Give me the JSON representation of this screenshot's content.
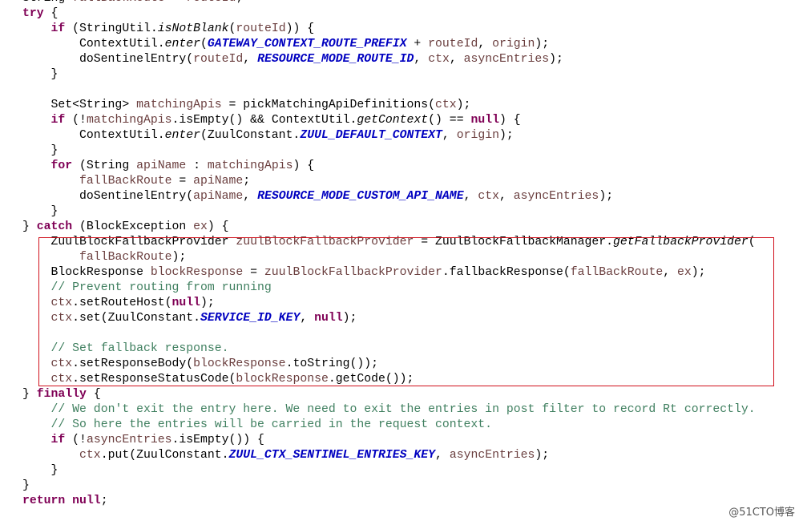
{
  "highlight_color": "#d0101c",
  "watermark": "@51CTO博客",
  "lines": [
    [
      [
        "p",
        "String "
      ],
      [
        "v",
        "fallBackRoute"
      ],
      [
        "p",
        " = "
      ],
      [
        "v",
        "routeId"
      ],
      [
        "p",
        ";"
      ]
    ],
    [
      [
        "k",
        "try"
      ],
      [
        "p",
        " {"
      ]
    ],
    [
      [
        "p",
        "    "
      ],
      [
        "k",
        "if"
      ],
      [
        "p",
        " (StringUtil."
      ],
      [
        "s",
        "isNotBlank"
      ],
      [
        "p",
        "("
      ],
      [
        "v",
        "routeId"
      ],
      [
        "p",
        ")) {"
      ]
    ],
    [
      [
        "p",
        "        ContextUtil."
      ],
      [
        "s",
        "enter"
      ],
      [
        "p",
        "("
      ],
      [
        "f",
        "GATEWAY_CONTEXT_ROUTE_PREFIX"
      ],
      [
        "p",
        " + "
      ],
      [
        "v",
        "routeId"
      ],
      [
        "p",
        ", "
      ],
      [
        "v",
        "origin"
      ],
      [
        "p",
        ");"
      ]
    ],
    [
      [
        "p",
        "        doSentinelEntry("
      ],
      [
        "v",
        "routeId"
      ],
      [
        "p",
        ", "
      ],
      [
        "f",
        "RESOURCE_MODE_ROUTE_ID"
      ],
      [
        "p",
        ", "
      ],
      [
        "v",
        "ctx"
      ],
      [
        "p",
        ", "
      ],
      [
        "v",
        "asyncEntries"
      ],
      [
        "p",
        ");"
      ]
    ],
    [
      [
        "p",
        "    }"
      ]
    ],
    [],
    [
      [
        "p",
        "    Set<String> "
      ],
      [
        "v",
        "matchingApis"
      ],
      [
        "p",
        " = pickMatchingApiDefinitions("
      ],
      [
        "v",
        "ctx"
      ],
      [
        "p",
        ");"
      ]
    ],
    [
      [
        "p",
        "    "
      ],
      [
        "k",
        "if"
      ],
      [
        "p",
        " (!"
      ],
      [
        "v",
        "matchingApis"
      ],
      [
        "p",
        ".isEmpty() && ContextUtil."
      ],
      [
        "s",
        "getContext"
      ],
      [
        "p",
        "() == "
      ],
      [
        "k",
        "null"
      ],
      [
        "p",
        ") {"
      ]
    ],
    [
      [
        "p",
        "        ContextUtil."
      ],
      [
        "s",
        "enter"
      ],
      [
        "p",
        "(ZuulConstant."
      ],
      [
        "f",
        "ZUUL_DEFAULT_CONTEXT"
      ],
      [
        "p",
        ", "
      ],
      [
        "v",
        "origin"
      ],
      [
        "p",
        ");"
      ]
    ],
    [
      [
        "p",
        "    }"
      ]
    ],
    [
      [
        "p",
        "    "
      ],
      [
        "k",
        "for"
      ],
      [
        "p",
        " (String "
      ],
      [
        "v",
        "apiName"
      ],
      [
        "p",
        " : "
      ],
      [
        "v",
        "matchingApis"
      ],
      [
        "p",
        ") {"
      ]
    ],
    [
      [
        "p",
        "        "
      ],
      [
        "v",
        "fallBackRoute"
      ],
      [
        "p",
        " = "
      ],
      [
        "v",
        "apiName"
      ],
      [
        "p",
        ";"
      ]
    ],
    [
      [
        "p",
        "        doSentinelEntry("
      ],
      [
        "v",
        "apiName"
      ],
      [
        "p",
        ", "
      ],
      [
        "f",
        "RESOURCE_MODE_CUSTOM_API_NAME"
      ],
      [
        "p",
        ", "
      ],
      [
        "v",
        "ctx"
      ],
      [
        "p",
        ", "
      ],
      [
        "v",
        "asyncEntries"
      ],
      [
        "p",
        ");"
      ]
    ],
    [
      [
        "p",
        "    }"
      ]
    ],
    [
      [
        "p",
        "} "
      ],
      [
        "k",
        "catch"
      ],
      [
        "p",
        " (BlockException "
      ],
      [
        "v",
        "ex"
      ],
      [
        "p",
        ") {"
      ]
    ],
    [
      [
        "p",
        "    ZuulBlockFallbackProvider "
      ],
      [
        "v",
        "zuulBlockFallbackProvider"
      ],
      [
        "p",
        " = ZuulBlockFallbackManager."
      ],
      [
        "s",
        "getFallbackProvider"
      ],
      [
        "p",
        "("
      ]
    ],
    [
      [
        "p",
        "        "
      ],
      [
        "v",
        "fallBackRoute"
      ],
      [
        "p",
        ");"
      ]
    ],
    [
      [
        "p",
        "    BlockResponse "
      ],
      [
        "v",
        "blockResponse"
      ],
      [
        "p",
        " = "
      ],
      [
        "v",
        "zuulBlockFallbackProvider"
      ],
      [
        "p",
        ".fallbackResponse("
      ],
      [
        "v",
        "fallBackRoute"
      ],
      [
        "p",
        ", "
      ],
      [
        "v",
        "ex"
      ],
      [
        "p",
        ");"
      ]
    ],
    [
      [
        "p",
        "    "
      ],
      [
        "c",
        "// Prevent routing from running"
      ]
    ],
    [
      [
        "p",
        "    "
      ],
      [
        "v",
        "ctx"
      ],
      [
        "p",
        ".setRouteHost("
      ],
      [
        "k",
        "null"
      ],
      [
        "p",
        ");"
      ]
    ],
    [
      [
        "p",
        "    "
      ],
      [
        "v",
        "ctx"
      ],
      [
        "p",
        ".set(ZuulConstant."
      ],
      [
        "f",
        "SERVICE_ID_KEY"
      ],
      [
        "p",
        ", "
      ],
      [
        "k",
        "null"
      ],
      [
        "p",
        ");"
      ]
    ],
    [],
    [
      [
        "p",
        "    "
      ],
      [
        "c",
        "// Set fallback response."
      ]
    ],
    [
      [
        "p",
        "    "
      ],
      [
        "v",
        "ctx"
      ],
      [
        "p",
        ".setResponseBody("
      ],
      [
        "v",
        "blockResponse"
      ],
      [
        "p",
        ".toString());"
      ]
    ],
    [
      [
        "p",
        "    "
      ],
      [
        "v",
        "ctx"
      ],
      [
        "p",
        ".setResponseStatusCode("
      ],
      [
        "v",
        "blockResponse"
      ],
      [
        "p",
        ".getCode());"
      ]
    ],
    [
      [
        "p",
        "} "
      ],
      [
        "k",
        "finally"
      ],
      [
        "p",
        " {"
      ]
    ],
    [
      [
        "p",
        "    "
      ],
      [
        "c",
        "// We don't exit the entry here. We need to exit the entries in post filter to record Rt correctly."
      ]
    ],
    [
      [
        "p",
        "    "
      ],
      [
        "c",
        "// So here the entries will be carried in the request context."
      ]
    ],
    [
      [
        "p",
        "    "
      ],
      [
        "k",
        "if"
      ],
      [
        "p",
        " (!"
      ],
      [
        "v",
        "asyncEntries"
      ],
      [
        "p",
        ".isEmpty()) {"
      ]
    ],
    [
      [
        "p",
        "        "
      ],
      [
        "v",
        "ctx"
      ],
      [
        "p",
        ".put(ZuulConstant."
      ],
      [
        "f",
        "ZUUL_CTX_SENTINEL_ENTRIES_KEY"
      ],
      [
        "p",
        ", "
      ],
      [
        "v",
        "asyncEntries"
      ],
      [
        "p",
        ");"
      ]
    ],
    [
      [
        "p",
        "    }"
      ]
    ],
    [
      [
        "p",
        "}"
      ]
    ],
    [
      [
        "k",
        "return"
      ],
      [
        "p",
        " "
      ],
      [
        "k",
        "null"
      ],
      [
        "p",
        ";"
      ]
    ]
  ]
}
